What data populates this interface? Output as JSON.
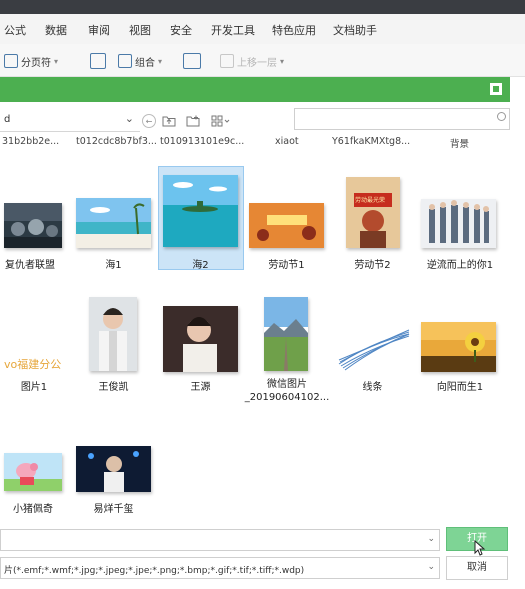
{
  "menu": [
    "公式",
    "数据",
    "审阅",
    "视图",
    "安全",
    "开发工具",
    "特色应用",
    "文档助手"
  ],
  "toolbar": {
    "page_break": "分页符",
    "group": "组合",
    "prev_layer": "上移一层"
  },
  "nav": {
    "path_text": "d",
    "search_placeholder": ""
  },
  "top_row_names": [
    "31b2bb2e...",
    "t012cdc8b7bf3...",
    "t010913101e9c...",
    "xiaot",
    "Y61fkaKMXtg8...",
    "背景"
  ],
  "files": [
    {
      "name": "复仇者联盟",
      "selected": false
    },
    {
      "name": "海1",
      "selected": false
    },
    {
      "name": "海2",
      "selected": true
    },
    {
      "name": "劳动节1",
      "selected": false
    },
    {
      "name": "劳动节2",
      "selected": false
    },
    {
      "name": "逆流而上的你1",
      "selected": false
    },
    {
      "name": "图片1",
      "selected": false
    },
    {
      "name": "王俊凯",
      "selected": false
    },
    {
      "name": "王源",
      "selected": false
    },
    {
      "name": "微信图片_20190604102...",
      "selected": false
    },
    {
      "name": "线条",
      "selected": false
    },
    {
      "name": "向阳而生1",
      "selected": false
    },
    {
      "name": "小猪佩奇",
      "selected": false
    },
    {
      "name": "易烊千玺",
      "selected": false
    }
  ],
  "labor_poster_text": "劳动最光荣",
  "image_text_sign": "vo福建分公",
  "file_name_value": "",
  "file_type_filter": "片(*.emf;*.wmf;*.jpg;*.jpeg;*.jpe;*.png;*.bmp;*.gif;*.tif;*.tiff;*.wdp)",
  "buttons": {
    "open": "打开",
    "cancel": "取消"
  },
  "colors": {
    "dialog_header": "#4caf50",
    "open_button": "#7ed495",
    "selection": "#cce4f7"
  }
}
